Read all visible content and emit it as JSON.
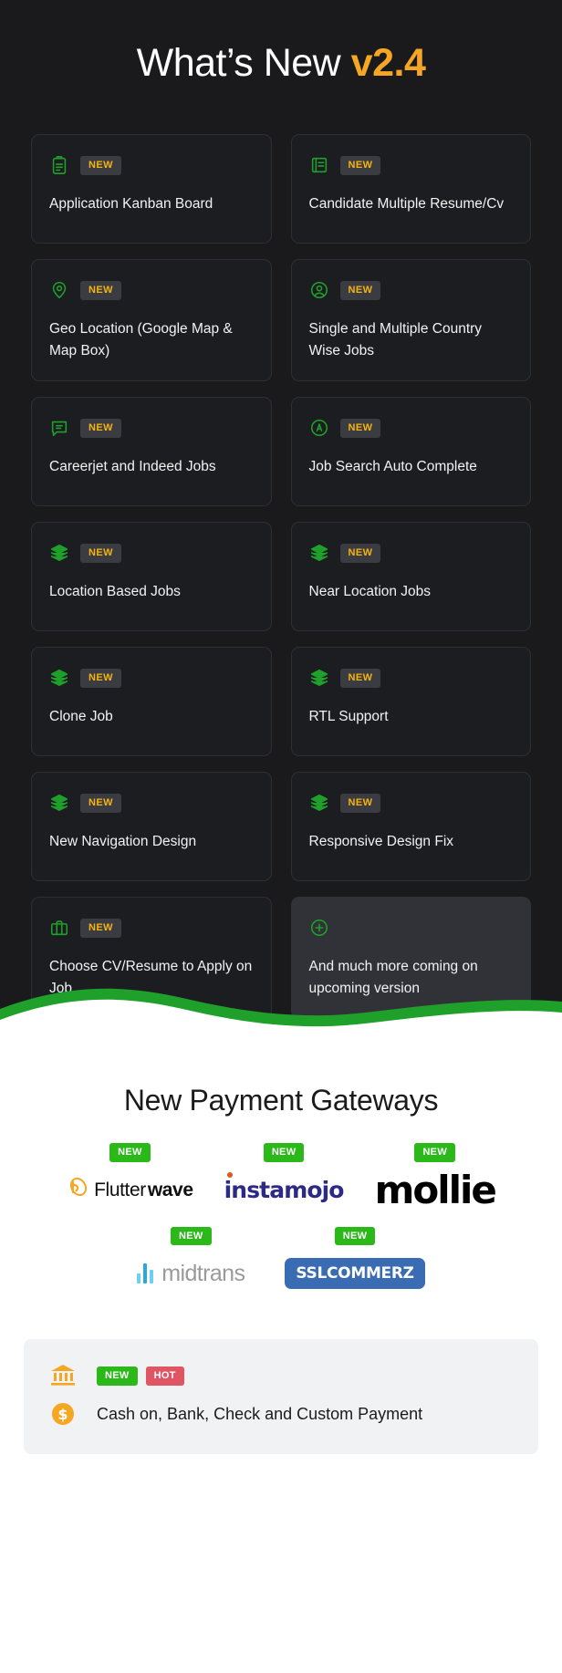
{
  "header": {
    "title_main": "What’s New ",
    "title_version": "v2.4"
  },
  "features": {
    "badge_label": "NEW",
    "cards": [
      {
        "icon": "clipboard-icon",
        "badge": "NEW",
        "title": "Application Kanban Board"
      },
      {
        "icon": "document-book-icon",
        "badge": "NEW",
        "title": "Candidate Multiple Resume/Cv"
      },
      {
        "icon": "map-pin-icon",
        "badge": "NEW",
        "title": "Geo Location (Google Map & Map Box)"
      },
      {
        "icon": "user-circle-icon",
        "badge": "NEW",
        "title": "Single and Multiple Country Wise Jobs"
      },
      {
        "icon": "message-icon",
        "badge": "NEW",
        "title": "Careerjet and Indeed Jobs"
      },
      {
        "icon": "autocomplete-circle-icon",
        "badge": "NEW",
        "title": "Job Search Auto Complete"
      },
      {
        "icon": "layers-icon",
        "badge": "NEW",
        "title": "Location Based Jobs"
      },
      {
        "icon": "layers-icon",
        "badge": "NEW",
        "title": "Near Location Jobs"
      },
      {
        "icon": "layers-icon",
        "badge": "NEW",
        "title": "Clone Job"
      },
      {
        "icon": "layers-icon",
        "badge": "NEW",
        "title": "RTL Support"
      },
      {
        "icon": "layers-icon",
        "badge": "NEW",
        "title": "New Navigation Design"
      },
      {
        "icon": "layers-icon",
        "badge": "NEW",
        "title": "Responsive Design Fix"
      },
      {
        "icon": "briefcase-icon",
        "badge": "NEW",
        "title": "Choose CV/Resume to Apply on Job"
      },
      {
        "icon": "plus-circle-icon",
        "badge": "",
        "title": "And much more coming on upcoming version"
      }
    ]
  },
  "gateways": {
    "title": "New Payment Gateways",
    "badge_label": "NEW",
    "row1": [
      {
        "name": "flutterwave",
        "text_light": "Flutter",
        "text_bold": "wave",
        "badge": "NEW"
      },
      {
        "name": "instamojo",
        "text": "instamojo",
        "badge": "NEW"
      },
      {
        "name": "mollie",
        "text": "mollie",
        "badge": "NEW"
      }
    ],
    "row2": [
      {
        "name": "midtrans",
        "text": "midtrans",
        "badge": "NEW"
      },
      {
        "name": "sslcommerz",
        "text": "SSLCOMMERZ",
        "badge": "NEW"
      }
    ]
  },
  "bottom_panel": {
    "badge_new": "NEW",
    "badge_hot": "HOT",
    "text": "Cash on, Bank, Check and Custom Payment"
  },
  "colors": {
    "dark_bg": "#1a1a1d",
    "card_bg": "#1c1d21",
    "card_border": "#2d2f34",
    "accent_green": "#1fa02a",
    "accent_orange": "#f5a623",
    "badge_yellow": "#f5b312",
    "green_badge": "#2bb819",
    "hot_red": "#e05563"
  }
}
